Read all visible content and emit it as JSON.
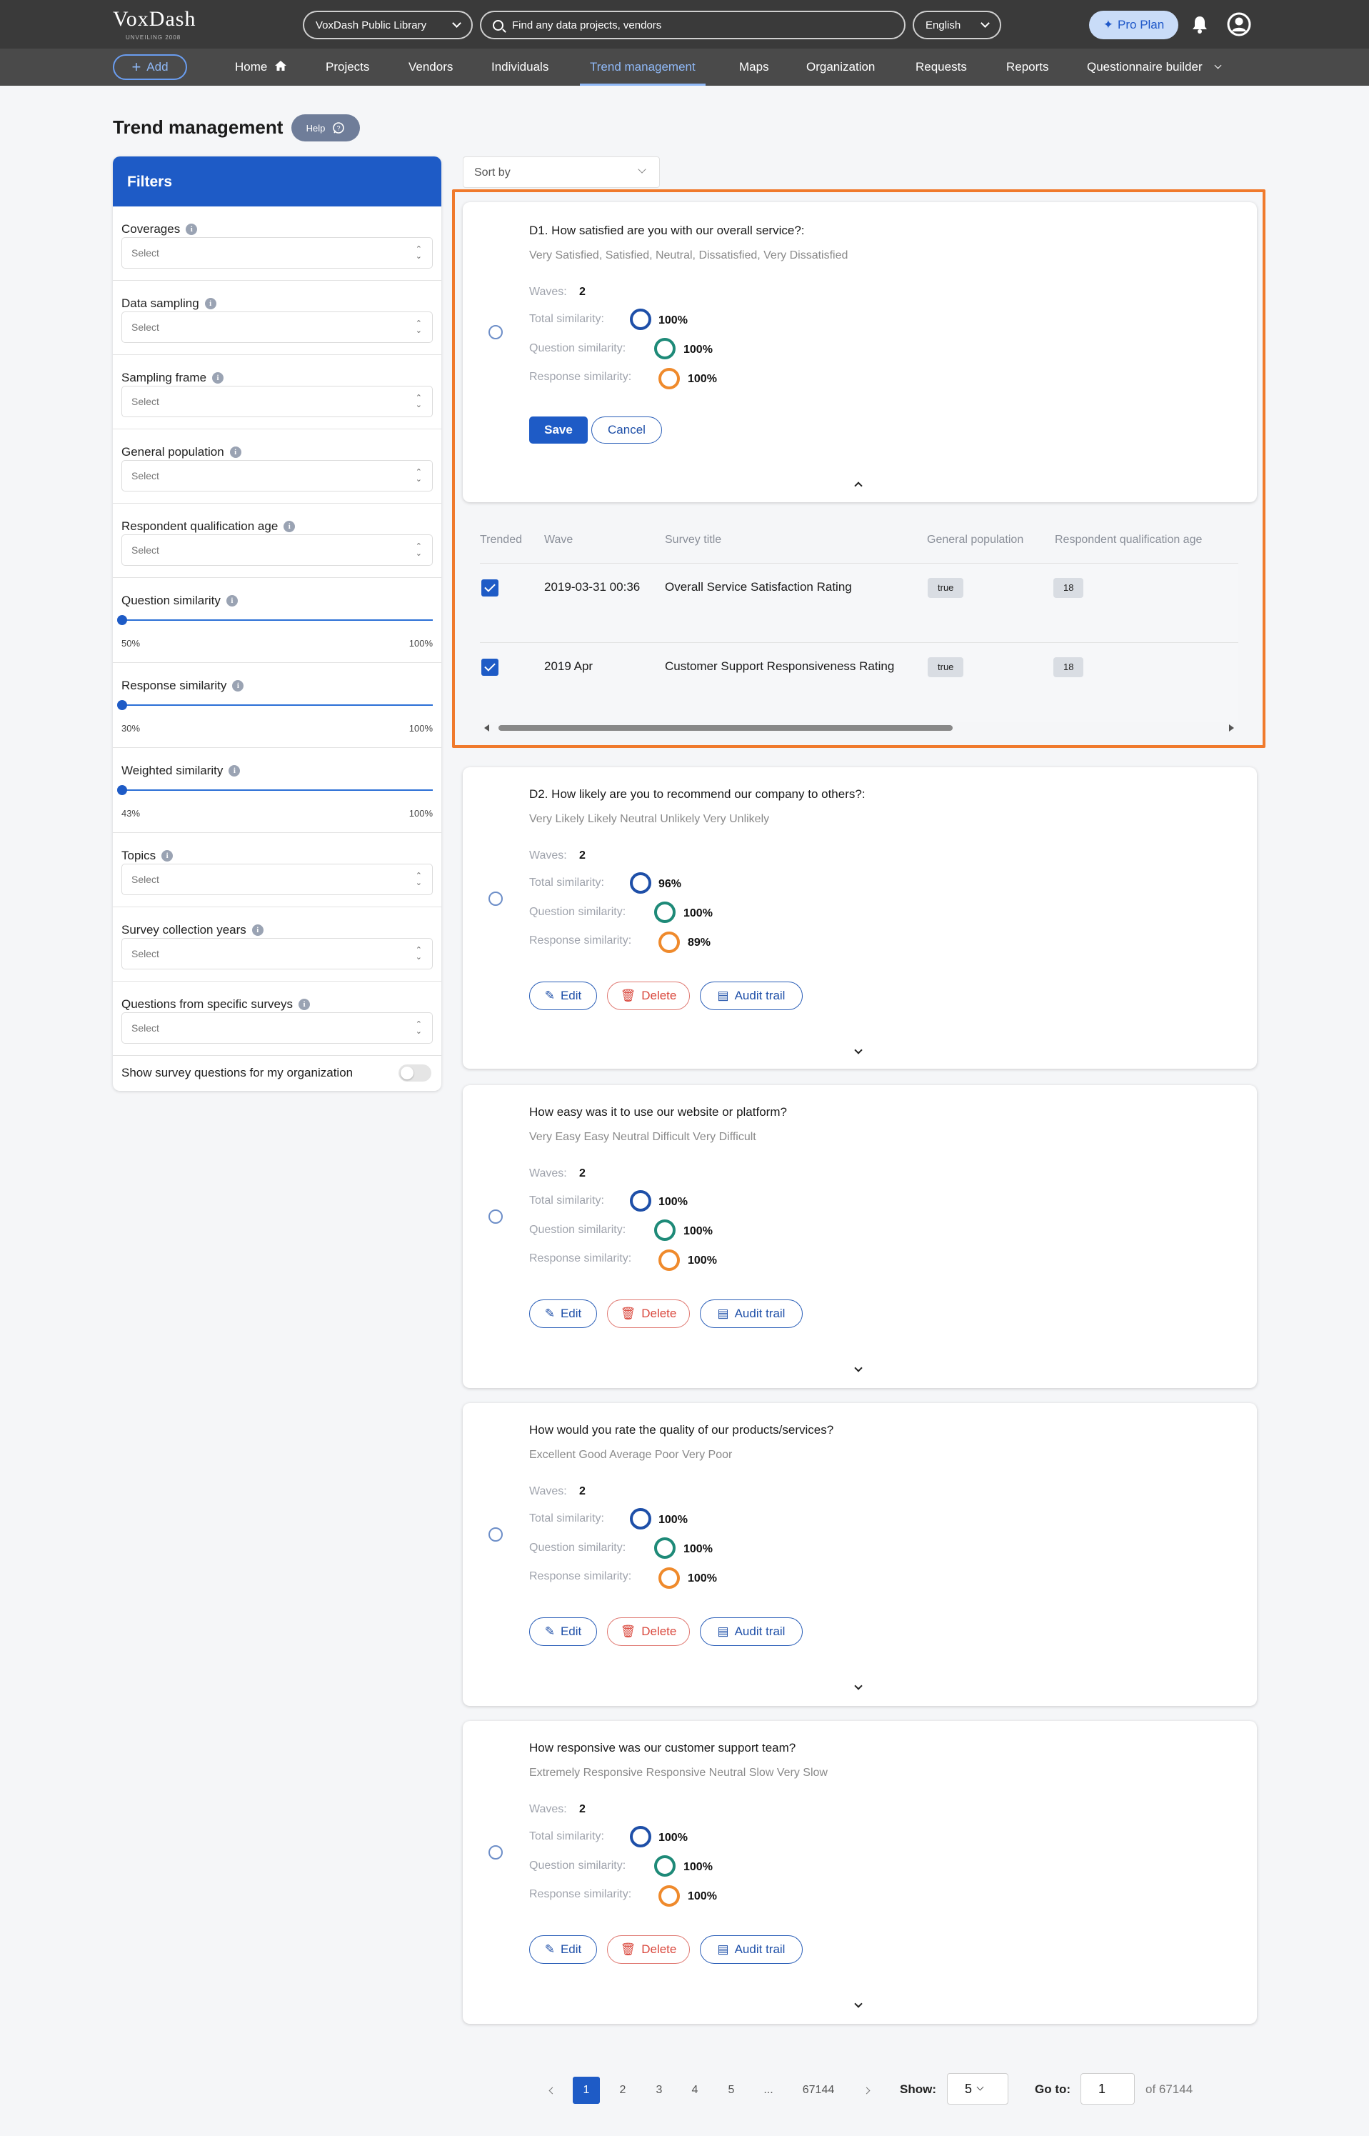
{
  "header": {
    "logo": "VoxDash",
    "logo_tagline": "UNVEILING 2008",
    "library_label": "VoxDash Public Library",
    "search_placeholder": "Find any data projects, vendors",
    "language": "English",
    "pro_label": "Pro Plan"
  },
  "nav": {
    "add_label": "Add",
    "items": [
      "Home",
      "Projects",
      "Vendors",
      "Individuals",
      "Trend management",
      "Maps",
      "Organization",
      "Requests",
      "Reports",
      "Questionnaire builder"
    ],
    "active": "Trend management"
  },
  "page": {
    "title": "Trend management",
    "help_label": "Help",
    "sort_label": "Sort by"
  },
  "filters": {
    "title": "Filters",
    "select_placeholder": "Select",
    "coverages": "Coverages",
    "data_sampling": "Data sampling",
    "sampling_frame": "Sampling frame",
    "general_population": "General population",
    "respondent_age": "Respondent qualification age",
    "question_similarity": {
      "label": "Question similarity",
      "min": "50%",
      "max": "100%",
      "value_fraction": 0
    },
    "response_similarity": {
      "label": "Response similarity",
      "min": "30%",
      "max": "100%",
      "value_fraction": 0
    },
    "weighted_similarity": {
      "label": "Weighted similarity",
      "min": "43%",
      "max": "100%",
      "value_fraction": 0
    },
    "topics": "Topics",
    "collection_years": "Survey collection years",
    "specific_surveys": "Questions from specific surveys",
    "show_org_questions": "Show survey questions for my organization"
  },
  "labels": {
    "waves": "Waves:",
    "total_similarity": "Total similarity:",
    "question_similarity": "Question similarity:",
    "response_similarity": "Response similarity:",
    "edit": "Edit",
    "delete": "Delete",
    "audit_trail": "Audit trail",
    "save": "Save",
    "cancel": "Cancel"
  },
  "colors": {
    "total": "#1e4fa8",
    "question": "#1e8a78",
    "response": "#ef8a2c",
    "accent": "#1e5bc6",
    "highlight": "#f07a2c"
  },
  "questions": [
    {
      "title": "D1. How satisfied are you with our overall service?:",
      "options": "Very Satisfied, Satisfied, Neutral, Dissatisfied, Very Dissatisfied",
      "waves": "2",
      "total": "100%",
      "question": "100%",
      "response": "100%"
    },
    {
      "title": "D2. How likely are you to recommend our company to others?:",
      "options": "Very Likely Likely Neutral Unlikely Very Unlikely",
      "waves": "2",
      "total": "96%",
      "question": "100%",
      "response": "89%"
    },
    {
      "title": "How easy was it to use our website or platform?",
      "options": "Very Easy Easy Neutral Difficult Very Difficult",
      "waves": "2",
      "total": "100%",
      "question": "100%",
      "response": "100%"
    },
    {
      "title": "How would you rate the quality of our products/services?",
      "options": "Excellent Good Average Poor Very Poor",
      "waves": "2",
      "total": "100%",
      "question": "100%",
      "response": "100%"
    },
    {
      "title": "How responsive was our customer support team?",
      "options": "Extremely Responsive Responsive Neutral Slow Very Slow",
      "waves": "2",
      "total": "100%",
      "question": "100%",
      "response": "100%"
    }
  ],
  "trend_table": {
    "headers": [
      "Trended",
      "Wave",
      "Survey title",
      "General population",
      "Respondent qualification age"
    ],
    "rows": [
      {
        "wave": "2019-03-31 00:36",
        "survey_title": "Overall Service Satisfaction Rating",
        "general_population": "true",
        "age": "18"
      },
      {
        "wave": "2019 Apr",
        "survey_title": "Customer Support Responsiveness Rating",
        "general_population": "true",
        "age": "18"
      }
    ]
  },
  "pagination": {
    "pages": [
      "1",
      "2",
      "3",
      "4",
      "5",
      "...",
      "67144"
    ],
    "current": "1",
    "show_label": "Show:",
    "show_value": "5",
    "goto_label": "Go to:",
    "goto_value": "1",
    "of_total": "of 67144"
  }
}
